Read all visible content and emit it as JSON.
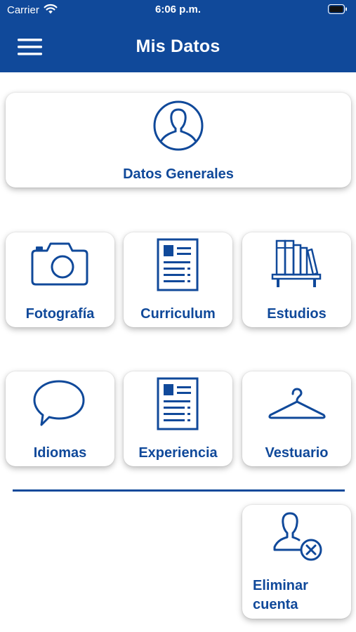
{
  "status_bar": {
    "carrier": "Carrier",
    "time": "6:06 p.m."
  },
  "header": {
    "title": "Mis Datos",
    "color": "#10499a"
  },
  "tiles": {
    "datos_generales": {
      "label": "Datos Generales",
      "icon": "user-circle-icon"
    },
    "fotografia": {
      "label": "Fotografía",
      "icon": "camera-icon"
    },
    "curriculum": {
      "label": "Curriculum",
      "icon": "document-icon"
    },
    "estudios": {
      "label": "Estudios",
      "icon": "bookshelf-icon"
    },
    "idiomas": {
      "label": "Idiomas",
      "icon": "speech-bubble-icon"
    },
    "experiencia": {
      "label": "Experiencia",
      "icon": "document-icon"
    },
    "vestuario": {
      "label": "Vestuario",
      "icon": "hanger-icon"
    },
    "eliminar_cuenta": {
      "label_line1": "Eliminar",
      "label_line2": "cuenta",
      "icon": "user-remove-icon"
    }
  }
}
